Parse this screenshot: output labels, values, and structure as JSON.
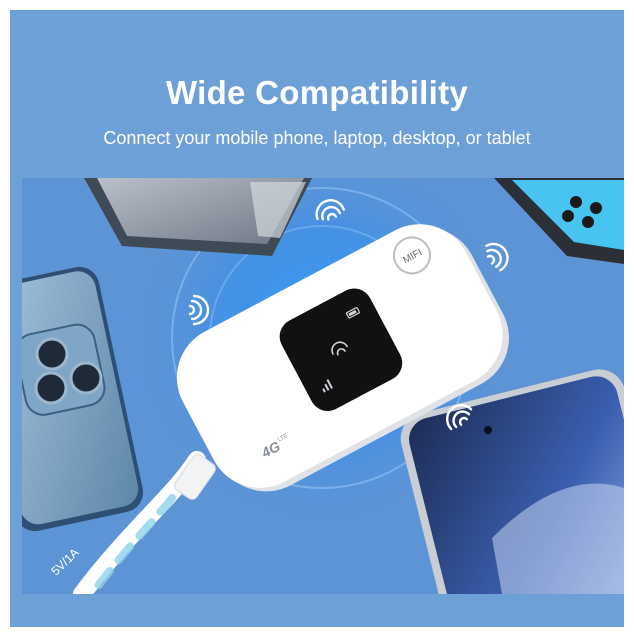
{
  "header": {
    "title": "Wide Compatibility",
    "subtitle": "Connect your mobile phone, laptop, desktop, or tablet"
  },
  "device": {
    "button_label": "MIFI",
    "network_badge": "4G",
    "network_badge_suffix": "LTE"
  },
  "cable": {
    "label": "5V/1A"
  },
  "colors": {
    "background": "#6ea0d8",
    "scene": "#5c94d6",
    "device_body": "#ffffff",
    "screen": "#111111"
  },
  "icons": [
    "wifi-signal-icon",
    "wifi-icon",
    "signal-bars-icon",
    "battery-icon"
  ]
}
